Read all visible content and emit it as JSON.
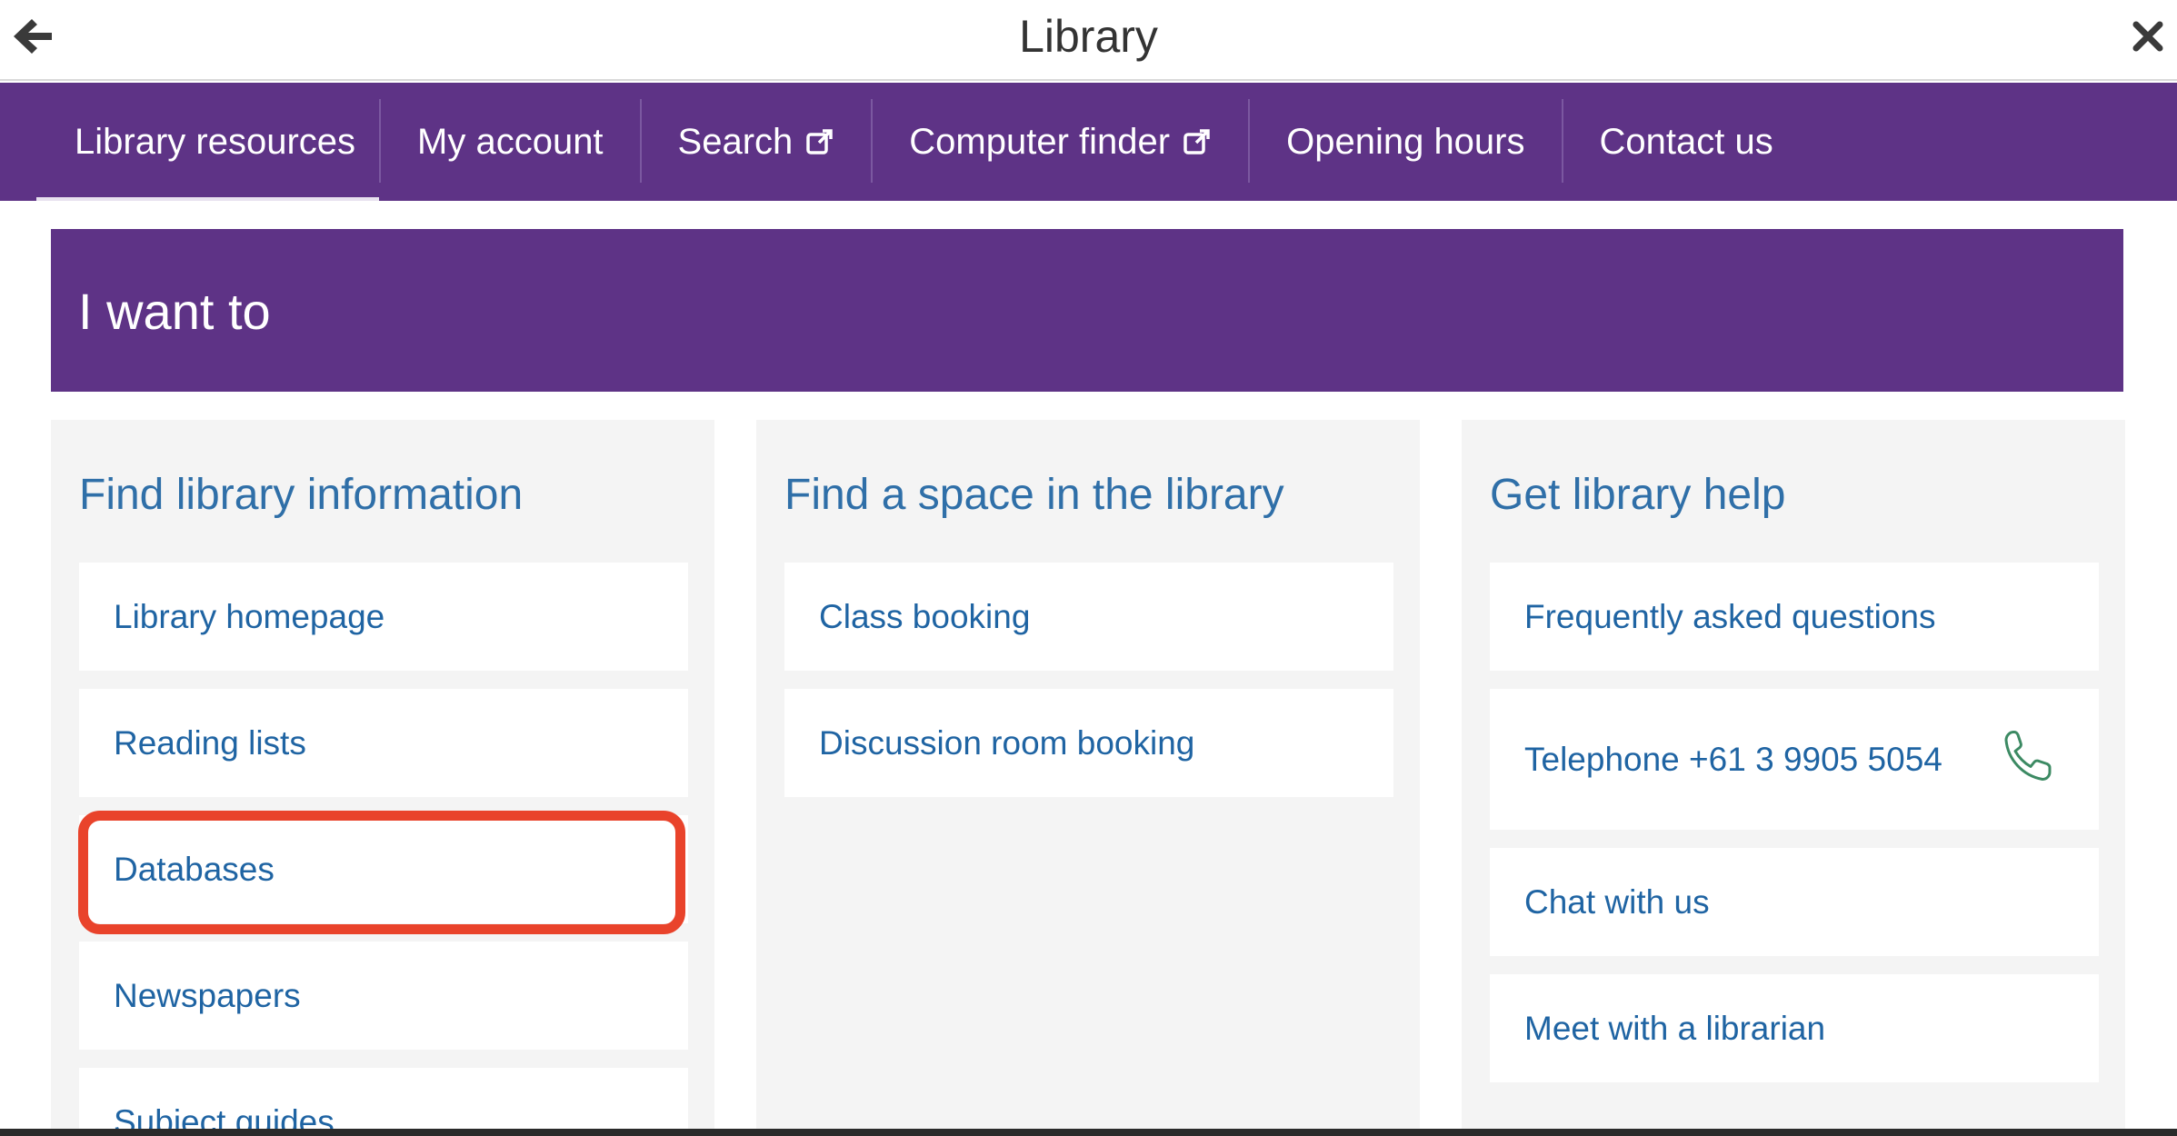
{
  "window": {
    "title": "Library",
    "back_icon": "arrow-left-icon",
    "close_icon": "close-icon"
  },
  "nav": {
    "items": [
      {
        "label": "Library resources",
        "active": true
      },
      {
        "label": "My account"
      },
      {
        "label": "Search",
        "icon": "external-link-icon"
      },
      {
        "label": "Computer finder",
        "icon": "external-link-icon"
      },
      {
        "label": "Opening hours"
      },
      {
        "label": "Contact us"
      }
    ]
  },
  "banner": {
    "title": "I want to"
  },
  "columns": [
    {
      "heading": "Find library information",
      "links": [
        "Library homepage",
        "Reading lists",
        "Databases",
        "Newspapers",
        "Subject guides"
      ]
    },
    {
      "heading": "Find a space in the library",
      "links": [
        "Class booking",
        "Discussion room booking"
      ]
    },
    {
      "heading": "Get library help",
      "links": [
        "Frequently asked questions",
        "Telephone +61 3 9905 5054",
        "Chat with us",
        "Meet with a librarian"
      ],
      "phone_icon": "phone-icon"
    }
  ],
  "colors": {
    "brand_purple": "#5e3386",
    "link_blue": "#1f64a3",
    "highlight_red": "#e9432b",
    "phone_green": "#3c8a63"
  }
}
